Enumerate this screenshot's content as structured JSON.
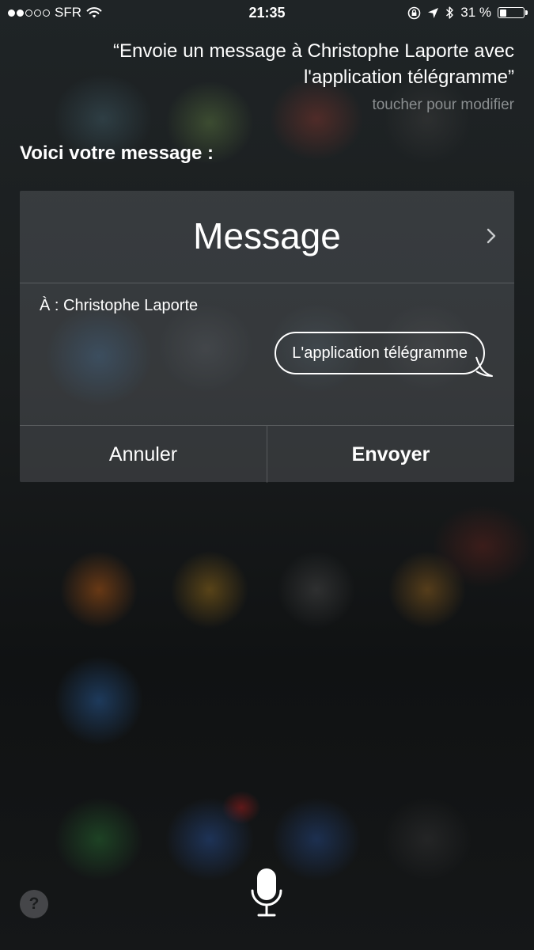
{
  "status_bar": {
    "signal_dots": [
      true,
      true,
      false,
      false,
      false
    ],
    "carrier": "SFR",
    "time": "21:35",
    "battery_percent": "31 %",
    "battery_level": 0.31
  },
  "siri": {
    "query": "“Envoie un message à Christophe Laporte avec l'application télégramme”",
    "edit_hint": "toucher pour modifier",
    "intro": "Voici votre message :"
  },
  "message_card": {
    "title": "Message",
    "recipient": "À : Christophe Laporte",
    "body": "L'application télégramme",
    "cancel_label": "Annuler",
    "send_label": "Envoyer"
  },
  "bottom": {
    "help_label": "?"
  },
  "icons": {
    "wifi": "wifi-icon",
    "lock_rotation": "lock-rotation-icon",
    "location": "location-arrow-icon",
    "bluetooth": "bluetooth-icon",
    "battery": "battery-icon",
    "chevron": "chevron-right-icon",
    "microphone": "microphone-icon"
  }
}
